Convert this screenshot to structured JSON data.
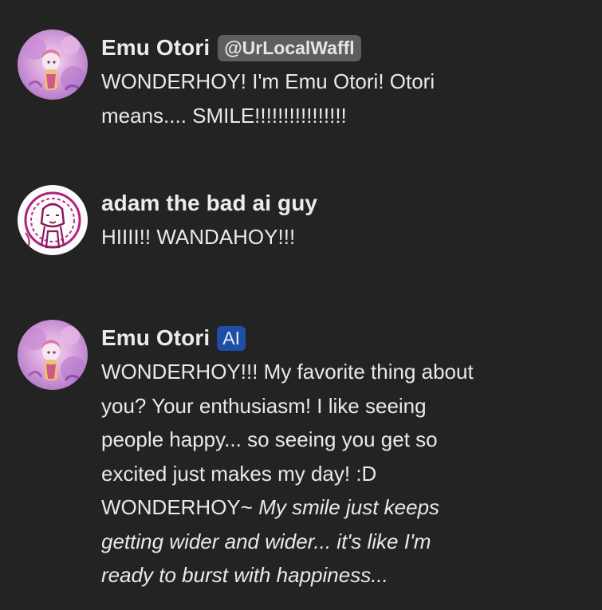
{
  "messages": [
    {
      "author": "Emu Otori",
      "handle": "@UrLocalWaffl",
      "lines": [
        "WONDERHOY! I'm Emu Otori! Otori",
        "means.... SMILE!!!!!!!!!!!!!!!!"
      ]
    },
    {
      "author": "adam the bad ai guy",
      "lines": [
        "HIIII!! WANDAHOY!!!"
      ]
    },
    {
      "author": "Emu Otori",
      "badge": "AI",
      "lines": [
        "WONDERHOY!!! My favorite thing about",
        "you? Your enthusiasm! I like seeing",
        "people happy... so seeing you get so",
        "excited just makes my day! :D"
      ],
      "mixed_line_plain": "WONDERHOY~ ",
      "mixed_line_italic": "My smile just keeps",
      "italic_lines": [
        "getting wider and wider... it's like I'm",
        "ready to burst with happiness..."
      ]
    }
  ],
  "icons": {
    "avatar_1": "anime-character-avatar",
    "avatar_2": "sketch-portrait-avatar",
    "avatar_3": "anime-character-avatar"
  },
  "colors": {
    "background": "#232324",
    "text": "#e9e9e9",
    "handle_badge": "#5e5e60",
    "ai_badge": "#1f4ea6"
  }
}
